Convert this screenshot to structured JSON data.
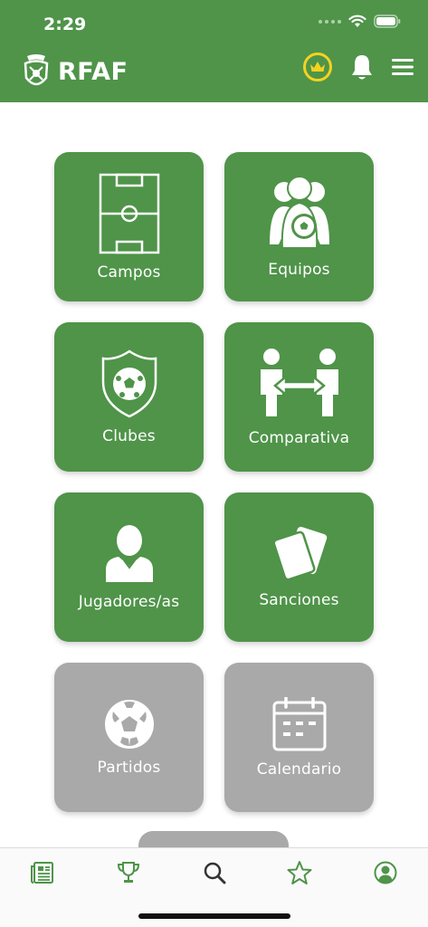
{
  "status_bar": {
    "time": "2:29"
  },
  "header": {
    "brand": "RFAF"
  },
  "menu": [
    {
      "label": "Campos",
      "icon": "football-field-icon",
      "enabled": true
    },
    {
      "label": "Equipos",
      "icon": "team-icon",
      "enabled": true
    },
    {
      "label": "Clubes",
      "icon": "club-shield-icon",
      "enabled": true
    },
    {
      "label": "Comparativa",
      "icon": "compare-icon",
      "enabled": true
    },
    {
      "label": "Jugadores/as",
      "icon": "player-icon",
      "enabled": true
    },
    {
      "label": "Sanciones",
      "icon": "cards-icon",
      "enabled": true
    },
    {
      "label": "Partidos",
      "icon": "soccer-ball-icon",
      "enabled": false
    },
    {
      "label": "Calendario",
      "icon": "calendar-icon",
      "enabled": false
    }
  ],
  "tabbar": [
    {
      "icon": "news-icon",
      "active": false
    },
    {
      "icon": "trophy-icon",
      "active": false
    },
    {
      "icon": "search-icon",
      "active": true
    },
    {
      "icon": "star-icon",
      "active": false
    },
    {
      "icon": "profile-icon",
      "active": false
    }
  ],
  "colors": {
    "primary": "#4f9449",
    "disabled": "#a9a9a9",
    "crown": "#f5d21f",
    "active_tab": "#333333"
  }
}
